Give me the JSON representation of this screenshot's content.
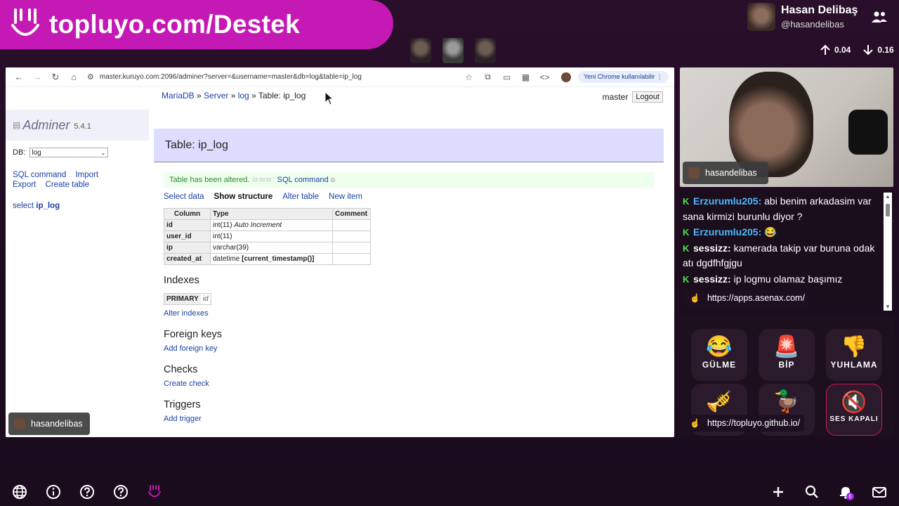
{
  "banner": {
    "text": "topluyo.com/Destek"
  },
  "profile": {
    "name": "Hasan Delibaş",
    "handle": "@hasandelibas"
  },
  "speeds": {
    "up": "0.04",
    "down": "0.16"
  },
  "browser": {
    "url": "master.kuruyo.com:2096/adminer?server=&username=master&db=log&table=ip_log",
    "chrome_pill": "Yeni Chrome kullanılabilir"
  },
  "adminer": {
    "breadcrumb": {
      "driver": "MariaDB",
      "server": "Server",
      "db": "log",
      "current": "Table: ip_log"
    },
    "user": "master",
    "logout": "Logout",
    "logo": "Adminer",
    "version": "5.4.1",
    "db_label": "DB:",
    "db_value": "log",
    "menu_links": [
      "SQL command",
      "Import",
      "Export",
      "Create table"
    ],
    "select_prefix": "select",
    "select_table": "ip_log",
    "title": "Table: ip_log",
    "message": "Table has been altered.",
    "message_time": "22:20:52",
    "message_link": "SQL command",
    "tabs": [
      "Select data",
      "Show structure",
      "Alter table",
      "New item"
    ],
    "columns_header": [
      "Column",
      "Type",
      "Comment"
    ],
    "columns": [
      {
        "name": "id",
        "type": "int(11)",
        "extra": "Auto Increment",
        "comment": ""
      },
      {
        "name": "user_id",
        "type": "int(11)",
        "extra": "",
        "comment": ""
      },
      {
        "name": "ip",
        "type": "varchar(39)",
        "extra": "",
        "comment": ""
      },
      {
        "name": "created_at",
        "type": "datetime",
        "extra": "[current_timestamp()]",
        "comment": ""
      }
    ],
    "indexes_title": "Indexes",
    "index_key": "PRIMARY",
    "index_col": "id",
    "alter_indexes": "Alter indexes",
    "fk_title": "Foreign keys",
    "add_fk": "Add foreign key",
    "checks_title": "Checks",
    "create_check": "Create check",
    "triggers_title": "Triggers",
    "add_trigger": "Add trigger"
  },
  "name_tags": {
    "left": "hasandelibas",
    "cam": "hasandelibas"
  },
  "chat": [
    {
      "user": "Erzurumlu205:",
      "text": "abi benim arkadasim var sana kirmizi burunlu diyor ?"
    },
    {
      "user": "Erzurumlu205:",
      "text": "😂"
    },
    {
      "user": "sessizz:",
      "text": "kamerada takip var buruna odak atı dgdfhfgjgu"
    },
    {
      "user": "sessizz:",
      "text": "ip logmu olamaz başımız"
    }
  ],
  "links": {
    "apps": "https://apps.asenax.com/",
    "github": "https://topluyo.github.io/"
  },
  "sounds": [
    {
      "icon": "😂",
      "label": "GÜLME"
    },
    {
      "icon": "🚨",
      "label": "BİP"
    },
    {
      "icon": "👎",
      "label": "YUHLAMA"
    },
    {
      "icon": "🎺",
      "label": ""
    },
    {
      "icon": "🦆",
      "label": ""
    },
    {
      "icon": "🔇",
      "label": "SES KAPALI"
    }
  ],
  "notifications": {
    "count": "6"
  }
}
